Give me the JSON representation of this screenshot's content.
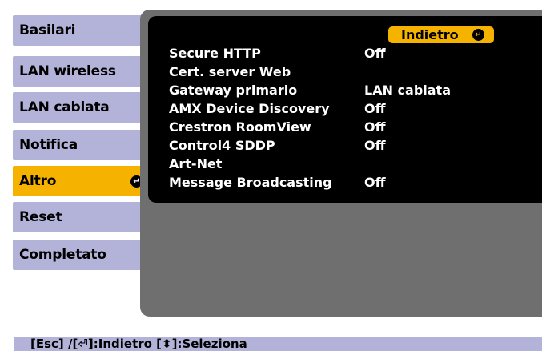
{
  "sidebar": {
    "items": [
      {
        "label": "Basilari"
      },
      {
        "label": "LAN wireless"
      },
      {
        "label": "LAN cablata"
      },
      {
        "label": "Notifica"
      },
      {
        "label": "Altro",
        "enter_icon": "enter-icon"
      },
      {
        "label": "Reset"
      },
      {
        "label": "Completato"
      }
    ]
  },
  "main": {
    "back_label": "Indietro",
    "rows": [
      {
        "label": "Secure HTTP",
        "value": "Off"
      },
      {
        "label": "Cert. server Web",
        "value": ""
      },
      {
        "label": "Gateway primario",
        "value": "LAN cablata"
      },
      {
        "label": "AMX Device Discovery",
        "value": "Off"
      },
      {
        "label": "Crestron RoomView",
        "value": "Off"
      },
      {
        "label": "Control4 SDDP",
        "value": "Off"
      },
      {
        "label": "Art-Net",
        "value": ""
      },
      {
        "label": "Message Broadcasting",
        "value": "Off"
      }
    ]
  },
  "footer": {
    "text": "[Esc] /[⏎]:Indietro  [⬍]:Seleziona"
  },
  "colors": {
    "menu_bg": "#b3b3d9",
    "accent": "#f5b300",
    "panel_bg": "#6f6f6f",
    "row_bg": "#000000"
  }
}
